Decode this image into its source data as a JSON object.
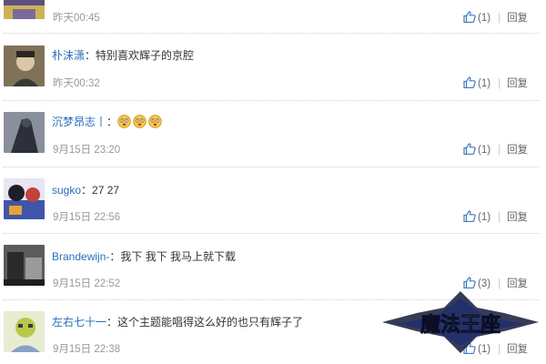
{
  "comments": [
    {
      "user": "",
      "text": "",
      "time": "昨天00:45",
      "likes": "(1)",
      "reply": "回复",
      "avatar_colors": [
        "#6b5a8a",
        "#d8c46a"
      ]
    },
    {
      "user": "朴沫潇",
      "sep": "：",
      "text": "特别喜欢辉子的京腔",
      "time": "昨天00:32",
      "likes": "(1)",
      "reply": "回复",
      "avatar_colors": [
        "#8b7b5e",
        "#3b3a32"
      ]
    },
    {
      "user": "沉梦昂志丨",
      "sep": "：",
      "text": "",
      "emoji": [
        "dizzy-face-emoji",
        "dizzy-face-emoji",
        "dizzy-face-emoji"
      ],
      "time": "9月15日 23:20",
      "likes": "(1)",
      "reply": "回复",
      "avatar_colors": [
        "#2d2f3a",
        "#8a8f9c"
      ]
    },
    {
      "user": "sugko",
      "sep": "：",
      "text": "27 27",
      "time": "9月15日 22:56",
      "likes": "(1)",
      "reply": "回复",
      "avatar_colors": [
        "#c2423a",
        "#3f56a8"
      ]
    },
    {
      "user": "Brandewijn-",
      "sep": "：",
      "text": "我下 我下 我马上就下载",
      "time": "9月15日 22:52",
      "likes": "(3)",
      "reply": "回复",
      "avatar_colors": [
        "#3a3a3a",
        "#9a9a9a"
      ]
    },
    {
      "user": "左右七十一",
      "sep": "：",
      "text": "这个主题能唱得这么好的也只有辉子了",
      "time": "9月15日 22:38",
      "likes": "(1)",
      "reply": "回复",
      "avatar_colors": [
        "#b8c84a",
        "#e8ecd0"
      ]
    }
  ],
  "watermark": {
    "text": "魔法王座"
  },
  "colors": {
    "username": "#2a6ebb",
    "meta": "#999999",
    "like_icon": "#3b7bc6",
    "divider": "#cfcfcf"
  }
}
